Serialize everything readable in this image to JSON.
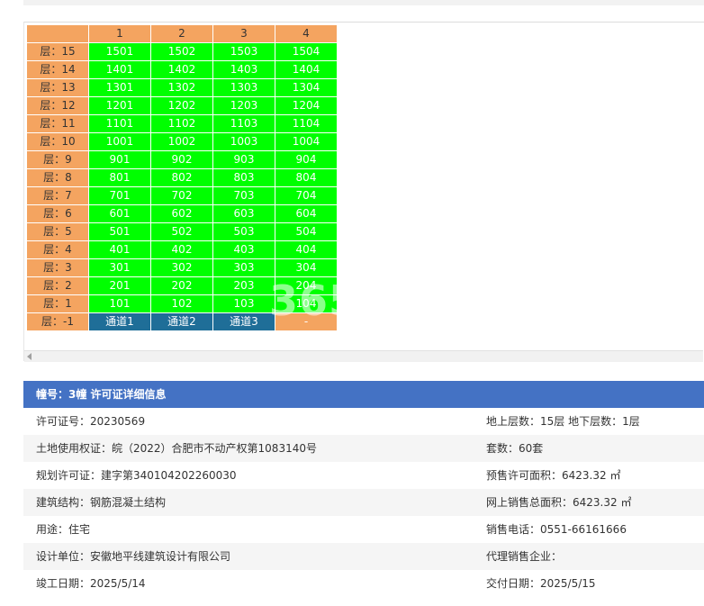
{
  "columns": [
    "",
    "1",
    "2",
    "3",
    "4"
  ],
  "floors": [
    {
      "label": "层：15",
      "units": [
        "1501",
        "1502",
        "1503",
        "1504"
      ]
    },
    {
      "label": "层：14",
      "units": [
        "1401",
        "1402",
        "1403",
        "1404"
      ]
    },
    {
      "label": "层：13",
      "units": [
        "1301",
        "1302",
        "1303",
        "1304"
      ]
    },
    {
      "label": "层：12",
      "units": [
        "1201",
        "1202",
        "1203",
        "1204"
      ]
    },
    {
      "label": "层：11",
      "units": [
        "1101",
        "1102",
        "1103",
        "1104"
      ]
    },
    {
      "label": "层：10",
      "units": [
        "1001",
        "1002",
        "1003",
        "1004"
      ]
    },
    {
      "label": "层：9",
      "units": [
        "901",
        "902",
        "903",
        "904"
      ]
    },
    {
      "label": "层：8",
      "units": [
        "801",
        "802",
        "803",
        "804"
      ]
    },
    {
      "label": "层：7",
      "units": [
        "701",
        "702",
        "703",
        "704"
      ]
    },
    {
      "label": "层：6",
      "units": [
        "601",
        "602",
        "603",
        "604"
      ]
    },
    {
      "label": "层：5",
      "units": [
        "501",
        "502",
        "503",
        "504"
      ]
    },
    {
      "label": "层：4",
      "units": [
        "401",
        "402",
        "403",
        "404"
      ]
    },
    {
      "label": "层：3",
      "units": [
        "301",
        "302",
        "303",
        "304"
      ]
    },
    {
      "label": "层：2",
      "units": [
        "201",
        "202",
        "203",
        "204"
      ]
    },
    {
      "label": "层：1",
      "units": [
        "101",
        "102",
        "103",
        "104"
      ]
    }
  ],
  "basement": {
    "label": "层：-1",
    "units": [
      "通道1",
      "通道2",
      "通道3",
      "-"
    ]
  },
  "watermark": "365",
  "colors": {
    "header": "#f4a460",
    "available": "#00ff00",
    "passage": "#1f6e98",
    "title_bar": "#4472c4"
  },
  "info": {
    "title": "幢号：3幢 许可证详细信息",
    "rows": [
      {
        "left": "许可证号：20230569",
        "right": "地上层数：15层  地下层数：1层"
      },
      {
        "left": "土地使用权证：皖（2022）合肥市不动产权第1083140号",
        "right": "套数：60套"
      },
      {
        "left": "规划许可证：建字第340104202260030",
        "right": "预售许可面积：6423.32 ㎡"
      },
      {
        "left": "建筑结构：钢筋混凝土结构",
        "right": "网上销售总面积：6423.32 ㎡"
      },
      {
        "left": "用途：住宅",
        "right": "销售电话：0551-66161666"
      },
      {
        "left": "设计单位：安徽地平线建筑设计有限公司",
        "right": "代理销售企业："
      },
      {
        "left": "竣工日期：2025/5/14",
        "right": "交付日期：2025/5/15"
      }
    ]
  }
}
